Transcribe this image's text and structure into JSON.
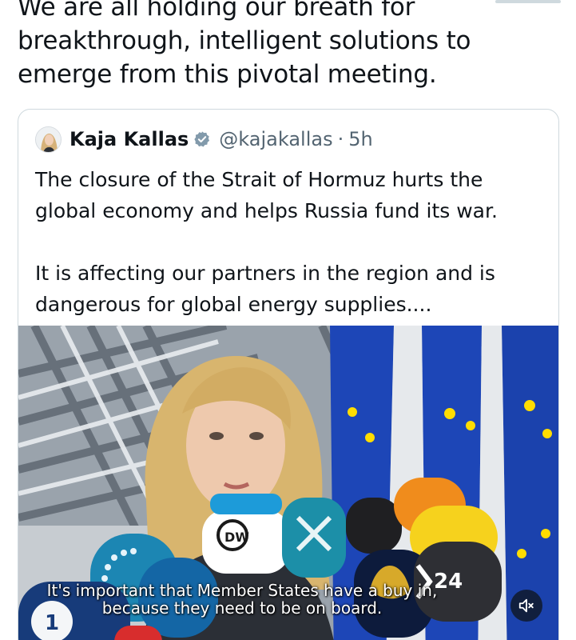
{
  "post": {
    "text": "We are all holding our breath for breakthrough, intelligent solutions to emerge from this pivotal meeting."
  },
  "quoted_post": {
    "author_name": "Kaja Kallas",
    "handle": "@kajakallas",
    "separator": "·",
    "time": "5h",
    "paragraphs": [
      "The closure of the Strait of Hormuz hurts the global economy and helps Russia fund its war.",
      "It is affecting our partners in the region and is dangerous for global energy supplies...."
    ],
    "video": {
      "subtitle_line1": "It's important that Member States have a buy in,",
      "subtitle_line2": "because they need to be on board.",
      "mic_labels": [
        "DW",
        "24"
      ]
    }
  },
  "colors": {
    "text_primary": "#0f1419",
    "text_secondary": "#536471",
    "verified_badge": "#829aab",
    "card_border": "#cfd9de",
    "eu_flag_blue": "#1d46b7",
    "eu_star_yellow": "#ffdd00"
  },
  "icons": {
    "verified": "verified-badge-icon",
    "mute": "speaker-muted-icon"
  }
}
